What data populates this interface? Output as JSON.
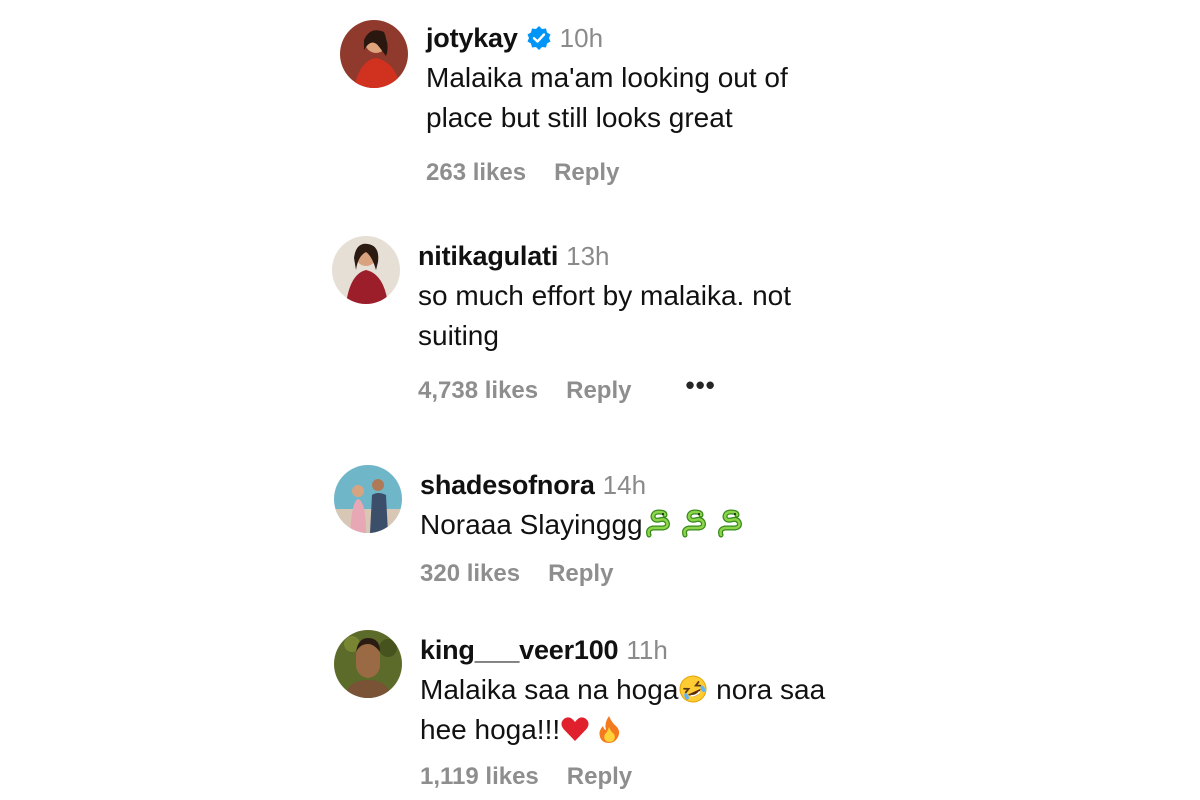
{
  "comments": [
    {
      "username": "jotykay",
      "verified": true,
      "time": "10h",
      "text_lines": [
        "Malaika ma'am looking out of",
        "place but still looks great"
      ],
      "likes": "263 likes",
      "reply": "Reply",
      "avatar_icon": "woman-red-dress-avatar"
    },
    {
      "username": "nitikagulati",
      "time": "13h",
      "text_lines": [
        "so much effort by malaika. not",
        "suiting"
      ],
      "likes": "4,738 likes",
      "reply": "Reply",
      "more": "•••",
      "avatar_icon": "woman-maroon-dress-avatar"
    },
    {
      "username": "shadesofnora",
      "time": "14h",
      "text": "Noraaa Slayinggg",
      "emojis": [
        "snake-emoji",
        "snake-emoji",
        "snake-emoji"
      ],
      "likes": "320 likes",
      "reply": "Reply",
      "avatar_icon": "couple-avatar"
    },
    {
      "username": "king___veer100",
      "time": "11h",
      "text_line1": "Malaika saa na hoga",
      "text_line1_emoji": "rolling-laughing-emoji",
      "text_line1_rest": " nora saa",
      "text_line2": "hee hoga!!!",
      "text_line2_emojis": [
        "red-heart-emoji",
        "fire-emoji"
      ],
      "likes": "1,119 likes",
      "reply": "Reply",
      "avatar_icon": "man-portrait-avatar"
    }
  ],
  "colors": {
    "verified_blue": "#0095f6",
    "muted_text": "#8e8e8e",
    "primary_text": "#111111"
  }
}
